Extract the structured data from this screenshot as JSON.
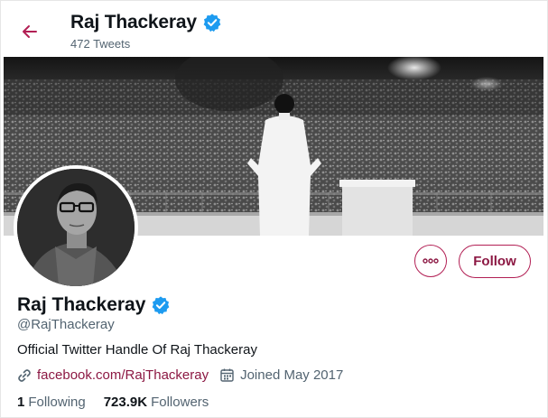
{
  "header": {
    "name": "Raj Thackeray",
    "tweet_count": "472 Tweets"
  },
  "profile": {
    "name": "Raj Thackeray",
    "handle": "@RajThackeray",
    "bio": "Official Twitter Handle Of Raj Thackeray",
    "website": "facebook.com/RajThackeray",
    "joined": "Joined May 2017",
    "following_count": "1",
    "following_label": "Following",
    "followers_count": "723.9K",
    "followers_label": "Followers",
    "verified": true
  },
  "actions": {
    "follow_label": "Follow",
    "more_icon": "more-horizontal-icon"
  },
  "colors": {
    "accent": "#b21f54",
    "accent_text": "#8c1843",
    "verified": "#1d9bf0",
    "secondary_text": "#536471"
  }
}
